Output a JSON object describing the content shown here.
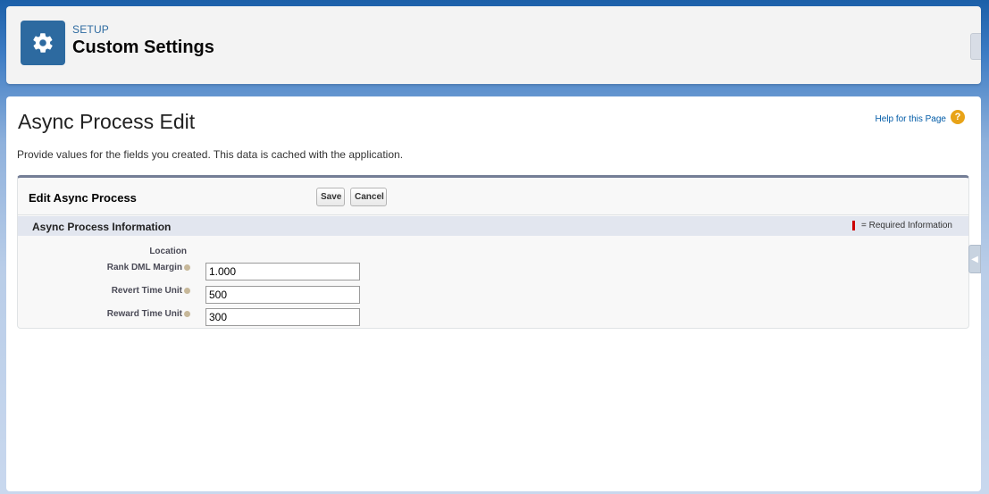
{
  "header": {
    "eyebrow": "SETUP",
    "title": "Custom Settings",
    "icon": "gear-icon"
  },
  "page": {
    "title": "Async Process Edit",
    "help_link": "Help for this Page",
    "help_icon": "?",
    "description": "Provide values for the fields you created. This data is cached with the application."
  },
  "edit_block": {
    "title": "Edit Async Process",
    "save_label": "Save",
    "cancel_label": "Cancel"
  },
  "section": {
    "title": "Async Process Information",
    "required_legend": "= Required Information"
  },
  "fields": {
    "location_label": "Location",
    "rank_dml_margin": {
      "label": "Rank DML Margin",
      "value": "1.000"
    },
    "revert_time_unit": {
      "label": "Revert Time Unit",
      "value": "500"
    },
    "reward_time_unit": {
      "label": "Reward Time Unit",
      "value": "300"
    }
  },
  "colors": {
    "brand_icon_bg": "#2d6aa0",
    "link": "#015ba7",
    "required": "#cc0000",
    "block_top_border": "#747e96"
  }
}
